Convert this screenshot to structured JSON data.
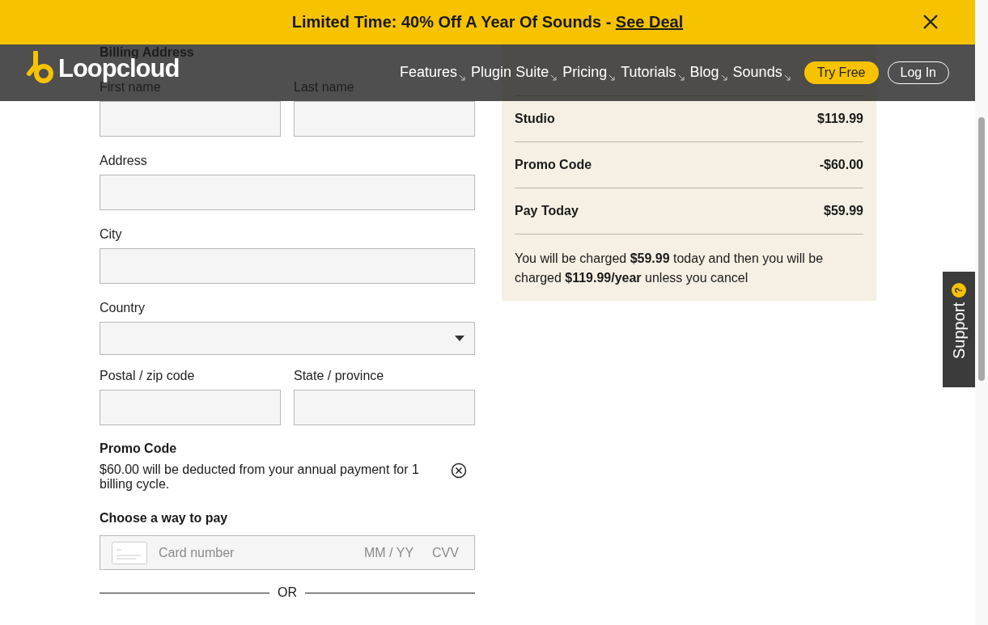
{
  "banner": {
    "text": "Limited Time: 40% Off A Year Of Sounds - ",
    "link": "See Deal"
  },
  "header": {
    "logo": "Loopcloud",
    "nav": [
      {
        "label": "Features"
      },
      {
        "label": "Plugin Suite"
      },
      {
        "label": "Pricing"
      },
      {
        "label": "Tutorials"
      },
      {
        "label": "Blog"
      },
      {
        "label": "Sounds"
      }
    ],
    "try_free": "Try Free",
    "log_in": "Log In"
  },
  "billing": {
    "title": "Billing Address",
    "rows": [
      [
        {
          "label": "First name",
          "kind": "text"
        },
        {
          "label": "Last name",
          "kind": "text"
        }
      ],
      [
        {
          "label": "Address",
          "kind": "text"
        }
      ],
      [
        {
          "label": "City",
          "kind": "text"
        }
      ],
      [
        {
          "label": "Country",
          "kind": "select"
        }
      ],
      [
        {
          "label": "Postal / zip code",
          "kind": "text"
        },
        {
          "label": "State / province",
          "kind": "text"
        }
      ]
    ]
  },
  "promo": {
    "title": "Promo Code",
    "message": "$60.00 will be deducted from your annual payment for 1 billing cycle."
  },
  "payment": {
    "title": "Choose a way to pay",
    "card_placeholder": "Card number",
    "expiry_placeholder": "MM / YY",
    "cvv_placeholder": "CVV",
    "divider": "OR"
  },
  "summary": {
    "lines": [
      {
        "label": "Studio",
        "amount": "$119.99"
      },
      {
        "label": "Promo Code",
        "amount": "-$60.00"
      },
      {
        "label": "Pay Today",
        "amount": "$59.99"
      }
    ],
    "note": "You will be charged **$59.99** today and then you will be charged **$119.99/year** unless you cancel"
  },
  "support": {
    "label": "Support",
    "badge": "?"
  }
}
